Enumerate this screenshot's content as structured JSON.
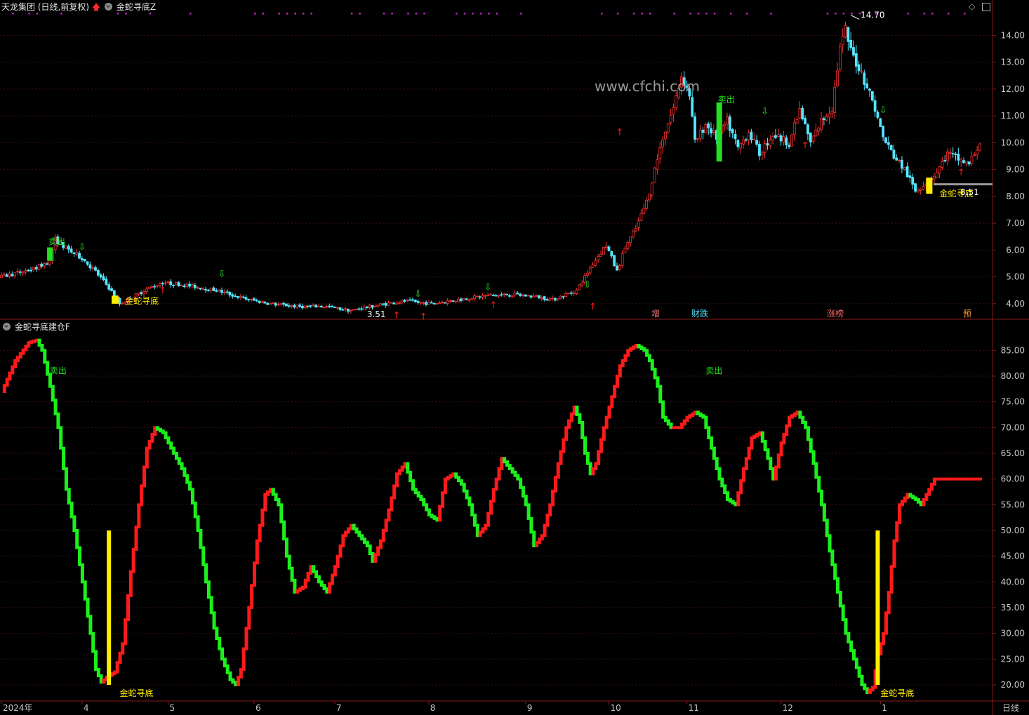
{
  "header": {
    "stock": "天龙集团",
    "mode": "(日线,前复权)",
    "indicator_top": "金蛇寻底Z",
    "indicator_bottom": "金蛇寻底建仓F"
  },
  "axis": {
    "period_label": "日线",
    "months": [
      "2024年",
      "4",
      "5",
      "6",
      "7",
      "8",
      "9",
      "10",
      "11",
      "12",
      "1"
    ]
  },
  "annotations": {
    "max_label": "14.70",
    "min_label": "3.51",
    "last_low_label": "8.51",
    "sell": "卖出",
    "bottom": "金蛇寻底",
    "events": [
      "增",
      "财跌",
      "涨榜",
      "预"
    ]
  },
  "colors": {
    "up": "#ff3030",
    "down": "#55e6ff",
    "ind_up": "#ff1a1a",
    "ind_down": "#1cf01c",
    "yellow": "#ffee00",
    "grid": "#3a1010",
    "axis_text": "#c8c8c8",
    "magenta": "#d020d0",
    "watermark": "#9a9a9a"
  },
  "chart_data": [
    {
      "type": "candlestick",
      "title": "金蛇寻底Z",
      "ylim": [
        3.5,
        14.9
      ],
      "yticks": [
        4.0,
        5.0,
        6.0,
        7.0,
        8.0,
        9.0,
        10.0,
        11.0,
        12.0,
        13.0,
        14.0
      ],
      "close_keypoints": [
        [
          0,
          5.0
        ],
        [
          12,
          5.3
        ],
        [
          18,
          5.6
        ],
        [
          20,
          6.4
        ],
        [
          25,
          6.0
        ],
        [
          30,
          5.7
        ],
        [
          35,
          5.2
        ],
        [
          40,
          4.6
        ],
        [
          44,
          4.0
        ],
        [
          48,
          4.2
        ],
        [
          53,
          4.5
        ],
        [
          60,
          4.8
        ],
        [
          68,
          4.7
        ],
        [
          80,
          4.5
        ],
        [
          90,
          4.2
        ],
        [
          100,
          4.0
        ],
        [
          110,
          3.9
        ],
        [
          120,
          3.9
        ],
        [
          130,
          3.75
        ],
        [
          140,
          3.95
        ],
        [
          150,
          4.1
        ],
        [
          160,
          4.0
        ],
        [
          170,
          4.15
        ],
        [
          180,
          4.3
        ],
        [
          190,
          4.35
        ],
        [
          200,
          4.25
        ],
        [
          205,
          4.15
        ],
        [
          214,
          4.5
        ],
        [
          220,
          5.5
        ],
        [
          225,
          6.2
        ],
        [
          229,
          5.2
        ],
        [
          232,
          6.1
        ],
        [
          236,
          6.8
        ],
        [
          240,
          7.8
        ],
        [
          243,
          9.0
        ],
        [
          246,
          10.2
        ],
        [
          250,
          11.3
        ],
        [
          253,
          12.5
        ],
        [
          256,
          11.8
        ],
        [
          258,
          10.0
        ],
        [
          262,
          10.7
        ],
        [
          266,
          10.2
        ],
        [
          270,
          10.8
        ],
        [
          274,
          9.8
        ],
        [
          278,
          10.4
        ],
        [
          282,
          9.6
        ],
        [
          287,
          10.3
        ],
        [
          293,
          10.0
        ],
        [
          297,
          11.2
        ],
        [
          301,
          10.0
        ],
        [
          305,
          10.8
        ],
        [
          309,
          11.3
        ],
        [
          312,
          13.5
        ],
        [
          314,
          14.2
        ],
        [
          316,
          13.4
        ],
        [
          320,
          12.6
        ],
        [
          324,
          11.6
        ],
        [
          328,
          10.2
        ],
        [
          332,
          9.5
        ],
        [
          336,
          9.0
        ],
        [
          340,
          8.2
        ],
        [
          344,
          8.55
        ],
        [
          348,
          8.9
        ],
        [
          352,
          9.6
        ],
        [
          356,
          9.4
        ],
        [
          360,
          9.2
        ],
        [
          364,
          10.0
        ]
      ],
      "max": 14.7,
      "min": 3.51,
      "last_low": 8.51,
      "sell_signals": [
        "2024-03",
        "2024-10"
      ],
      "bottom_signals": [
        "2024-04",
        "2025-01"
      ]
    },
    {
      "type": "line",
      "title": "金蛇寻底建仓F",
      "ylim": [
        17,
        89
      ],
      "yticks": [
        20,
        25,
        30,
        35,
        40,
        45,
        50,
        55,
        60,
        65,
        70,
        75,
        80,
        85
      ],
      "keypoints": [
        [
          0,
          77
        ],
        [
          5,
          83
        ],
        [
          10,
          86.5
        ],
        [
          13,
          87
        ],
        [
          15,
          85
        ],
        [
          18,
          78
        ],
        [
          21,
          70
        ],
        [
          24,
          58
        ],
        [
          27,
          50
        ],
        [
          30,
          40
        ],
        [
          33,
          30
        ],
        [
          35,
          23
        ],
        [
          37,
          20.5
        ],
        [
          39,
          21.5
        ],
        [
          42,
          22.5
        ],
        [
          45,
          28
        ],
        [
          48,
          42
        ],
        [
          51,
          55
        ],
        [
          54,
          66
        ],
        [
          57,
          70
        ],
        [
          60,
          69
        ],
        [
          63,
          66
        ],
        [
          67,
          62
        ],
        [
          70,
          58
        ],
        [
          73,
          50
        ],
        [
          76,
          40
        ],
        [
          79,
          31
        ],
        [
          82,
          25
        ],
        [
          85,
          21
        ],
        [
          87,
          20
        ],
        [
          89,
          23
        ],
        [
          92,
          35
        ],
        [
          95,
          48
        ],
        [
          98,
          57
        ],
        [
          100,
          58
        ],
        [
          103,
          55
        ],
        [
          106,
          45
        ],
        [
          109,
          38
        ],
        [
          112,
          39
        ],
        [
          115,
          43
        ],
        [
          118,
          40
        ],
        [
          121,
          38
        ],
        [
          124,
          43
        ],
        [
          127,
          49
        ],
        [
          130,
          51
        ],
        [
          133,
          49
        ],
        [
          136,
          47
        ],
        [
          138,
          44
        ],
        [
          141,
          48
        ],
        [
          144,
          54
        ],
        [
          147,
          61
        ],
        [
          150,
          63
        ],
        [
          153,
          58
        ],
        [
          156,
          56
        ],
        [
          159,
          53
        ],
        [
          162,
          52
        ],
        [
          165,
          60
        ],
        [
          168,
          61
        ],
        [
          171,
          59
        ],
        [
          174,
          55
        ],
        [
          177,
          49
        ],
        [
          180,
          51
        ],
        [
          183,
          58
        ],
        [
          186,
          64
        ],
        [
          189,
          62
        ],
        [
          192,
          60
        ],
        [
          195,
          55
        ],
        [
          198,
          47
        ],
        [
          201,
          49
        ],
        [
          204,
          55
        ],
        [
          207,
          63
        ],
        [
          210,
          70
        ],
        [
          213,
          74
        ],
        [
          215,
          71
        ],
        [
          217,
          65
        ],
        [
          219,
          61
        ],
        [
          221,
          63
        ],
        [
          224,
          70
        ],
        [
          227,
          76
        ],
        [
          230,
          82
        ],
        [
          233,
          85
        ],
        [
          236,
          86
        ],
        [
          239,
          85
        ],
        [
          241,
          83
        ],
        [
          244,
          78
        ],
        [
          246,
          72
        ],
        [
          249,
          70
        ],
        [
          252,
          70
        ],
        [
          255,
          72
        ],
        [
          258,
          73
        ],
        [
          261,
          72
        ],
        [
          264,
          66
        ],
        [
          267,
          60
        ],
        [
          270,
          56
        ],
        [
          273,
          55
        ],
        [
          276,
          62
        ],
        [
          279,
          68
        ],
        [
          282,
          69
        ],
        [
          285,
          64
        ],
        [
          287,
          60
        ],
        [
          290,
          67
        ],
        [
          293,
          72
        ],
        [
          296,
          73
        ],
        [
          299,
          70
        ],
        [
          302,
          63
        ],
        [
          305,
          55
        ],
        [
          308,
          46
        ],
        [
          311,
          38
        ],
        [
          314,
          30
        ],
        [
          317,
          25
        ],
        [
          320,
          20
        ],
        [
          322,
          18.5
        ],
        [
          324,
          19.5
        ],
        [
          326,
          26
        ],
        [
          328,
          30
        ],
        [
          330,
          38
        ],
        [
          332,
          48
        ],
        [
          334,
          55
        ],
        [
          337,
          57
        ],
        [
          340,
          56
        ],
        [
          342,
          55
        ],
        [
          344,
          57
        ],
        [
          347,
          60
        ]
      ],
      "bottom_bars_value": 50
    }
  ]
}
